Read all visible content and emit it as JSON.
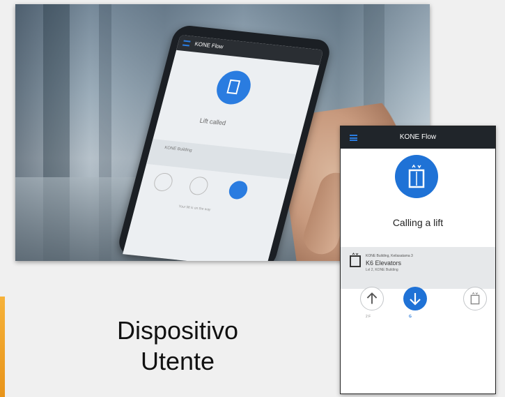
{
  "caption": {
    "line1": "Dispositivo",
    "line2": "Utente"
  },
  "background_phone": {
    "app_title": "KONE Flow",
    "status_text": "Lift called",
    "band_text": "KONE Building",
    "hint_text": "Your lift is on the way"
  },
  "front_phone": {
    "app_title": "KONE Flow",
    "status_text": "Calling a lift",
    "location_line": "KONE Building, Keilasatama 3",
    "group_name": "K6 Elevators",
    "group_sub": "Lvl 2, KONE Building",
    "up_label": "2 F",
    "down_label": "G",
    "accent_color": "#1f72d6",
    "top_bar_color": "#20252a"
  }
}
